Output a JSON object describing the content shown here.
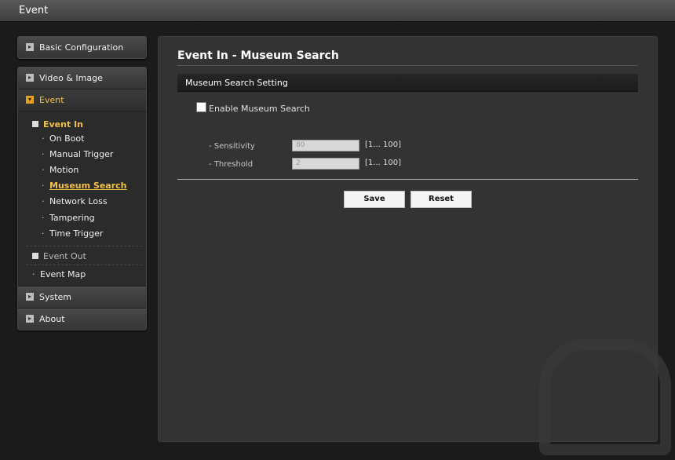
{
  "app": {
    "title": "Event"
  },
  "sidebar": {
    "basic_config": "Basic Configuration",
    "video_image": "Video & Image",
    "event": "Event",
    "event_in": "Event In",
    "event_in_items": [
      "On Boot",
      "Manual Trigger",
      "Motion",
      "Museum Search",
      "Network Loss",
      "Tampering",
      "Time Trigger"
    ],
    "event_out": "Event Out",
    "event_map": "Event Map",
    "system": "System",
    "about": "About"
  },
  "main": {
    "title": "Event In - Museum Search",
    "section": "Museum Search Setting",
    "enable_label": "Enable Museum Search",
    "enable_checked": false,
    "sensitivity": {
      "label": "- Sensitivity",
      "value": "80",
      "range": "[1... 100]"
    },
    "threshold": {
      "label": "- Threshold",
      "value": "2",
      "range": "[1... 100]"
    },
    "save_label": "Save",
    "reset_label": "Reset"
  }
}
